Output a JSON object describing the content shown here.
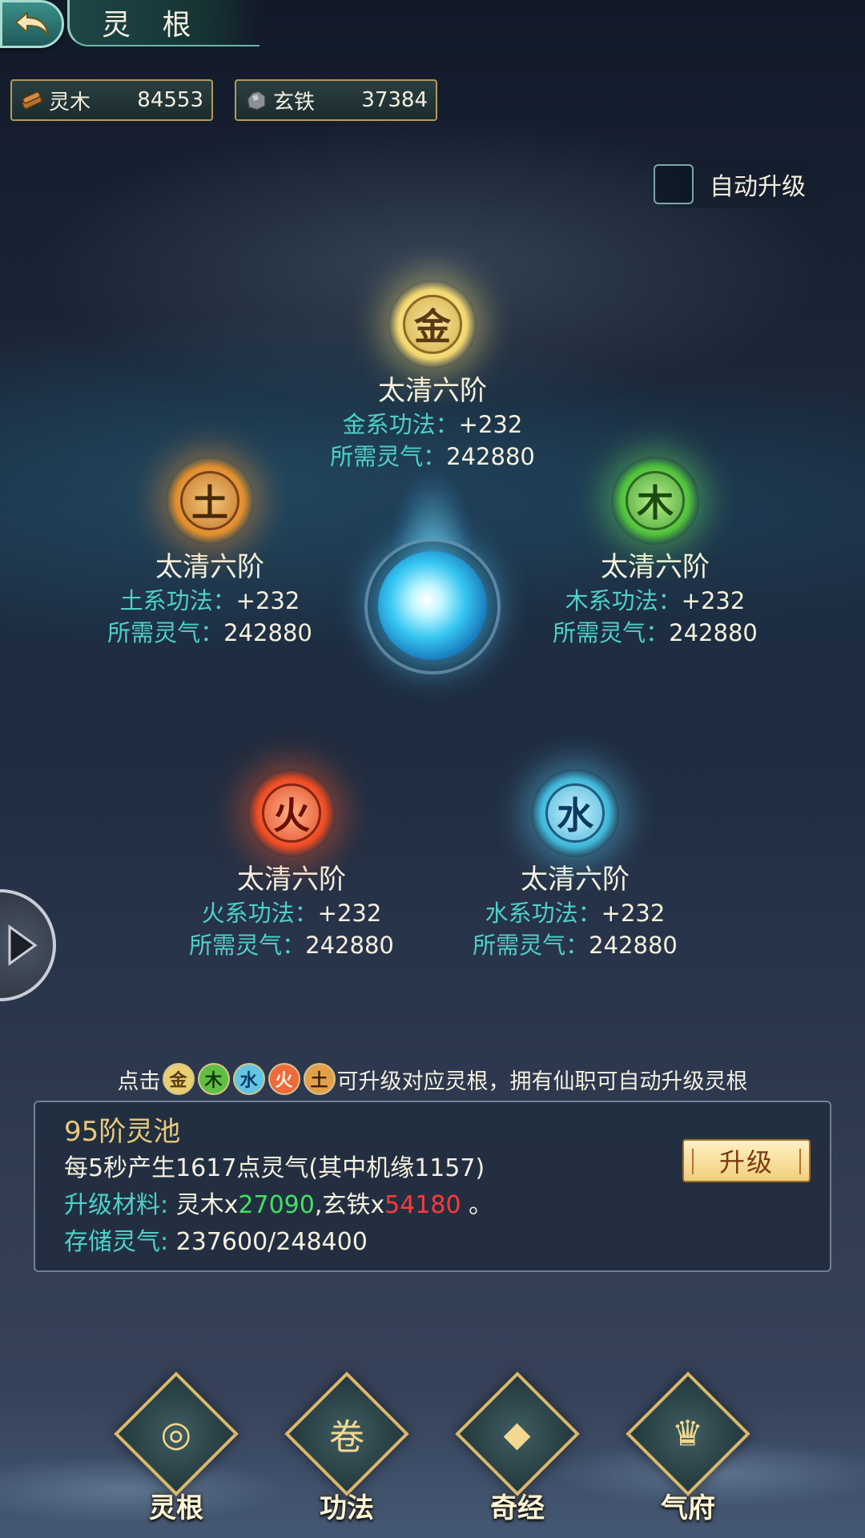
{
  "header": {
    "title": "灵 根"
  },
  "resources": [
    {
      "name": "灵木",
      "value": "84553",
      "icon": "wood-bundle-icon"
    },
    {
      "name": "玄铁",
      "value": "37384",
      "icon": "ore-icon"
    }
  ],
  "auto_upgrade": {
    "label": "自动升级",
    "checked": false
  },
  "nodes": {
    "gold": {
      "glyph": "金",
      "rank": "太清六阶",
      "stat_key": "金系功法：",
      "stat_val": "+232",
      "req_key": "所需灵气：",
      "req_val": "242880"
    },
    "earth": {
      "glyph": "土",
      "rank": "太清六阶",
      "stat_key": "土系功法：",
      "stat_val": "+232",
      "req_key": "所需灵气：",
      "req_val": "242880"
    },
    "wood": {
      "glyph": "木",
      "rank": "太清六阶",
      "stat_key": "木系功法：",
      "stat_val": "+232",
      "req_key": "所需灵气：",
      "req_val": "242880"
    },
    "fire": {
      "glyph": "火",
      "rank": "太清六阶",
      "stat_key": "火系功法：",
      "stat_val": "+232",
      "req_key": "所需灵气：",
      "req_val": "242880"
    },
    "water": {
      "glyph": "水",
      "rank": "太清六阶",
      "stat_key": "水系功法：",
      "stat_val": "+232",
      "req_key": "所需灵气：",
      "req_val": "242880"
    }
  },
  "hint": {
    "prefix": "点击",
    "icons": [
      "金",
      "木",
      "水",
      "火",
      "土"
    ],
    "suffix": "可升级对应灵根，拥有仙职可自动升级灵根"
  },
  "pool": {
    "title": "95阶灵池",
    "production": "每5秒产生1617点灵气(其中机缘1157)",
    "material_key": "升级材料:",
    "material_wood": " 灵木x",
    "material_wood_qty": "27090",
    "material_iron": ",玄铁x",
    "material_iron_qty": "54180",
    "material_end": " 。",
    "storage_key": "存储灵气:",
    "storage_val": " 237600/248400",
    "upgrade_label": "升级"
  },
  "nav": [
    {
      "label": "灵根",
      "glyph": "◎"
    },
    {
      "label": "功法",
      "glyph": "卷"
    },
    {
      "label": "奇经",
      "glyph": "◆"
    },
    {
      "label": "气府",
      "glyph": "♛"
    }
  ],
  "colors": {
    "accent": "#4fd0c8",
    "gold_text": "#e8c979",
    "green_qty": "#43e063",
    "red_qty": "#ff3a3a"
  }
}
